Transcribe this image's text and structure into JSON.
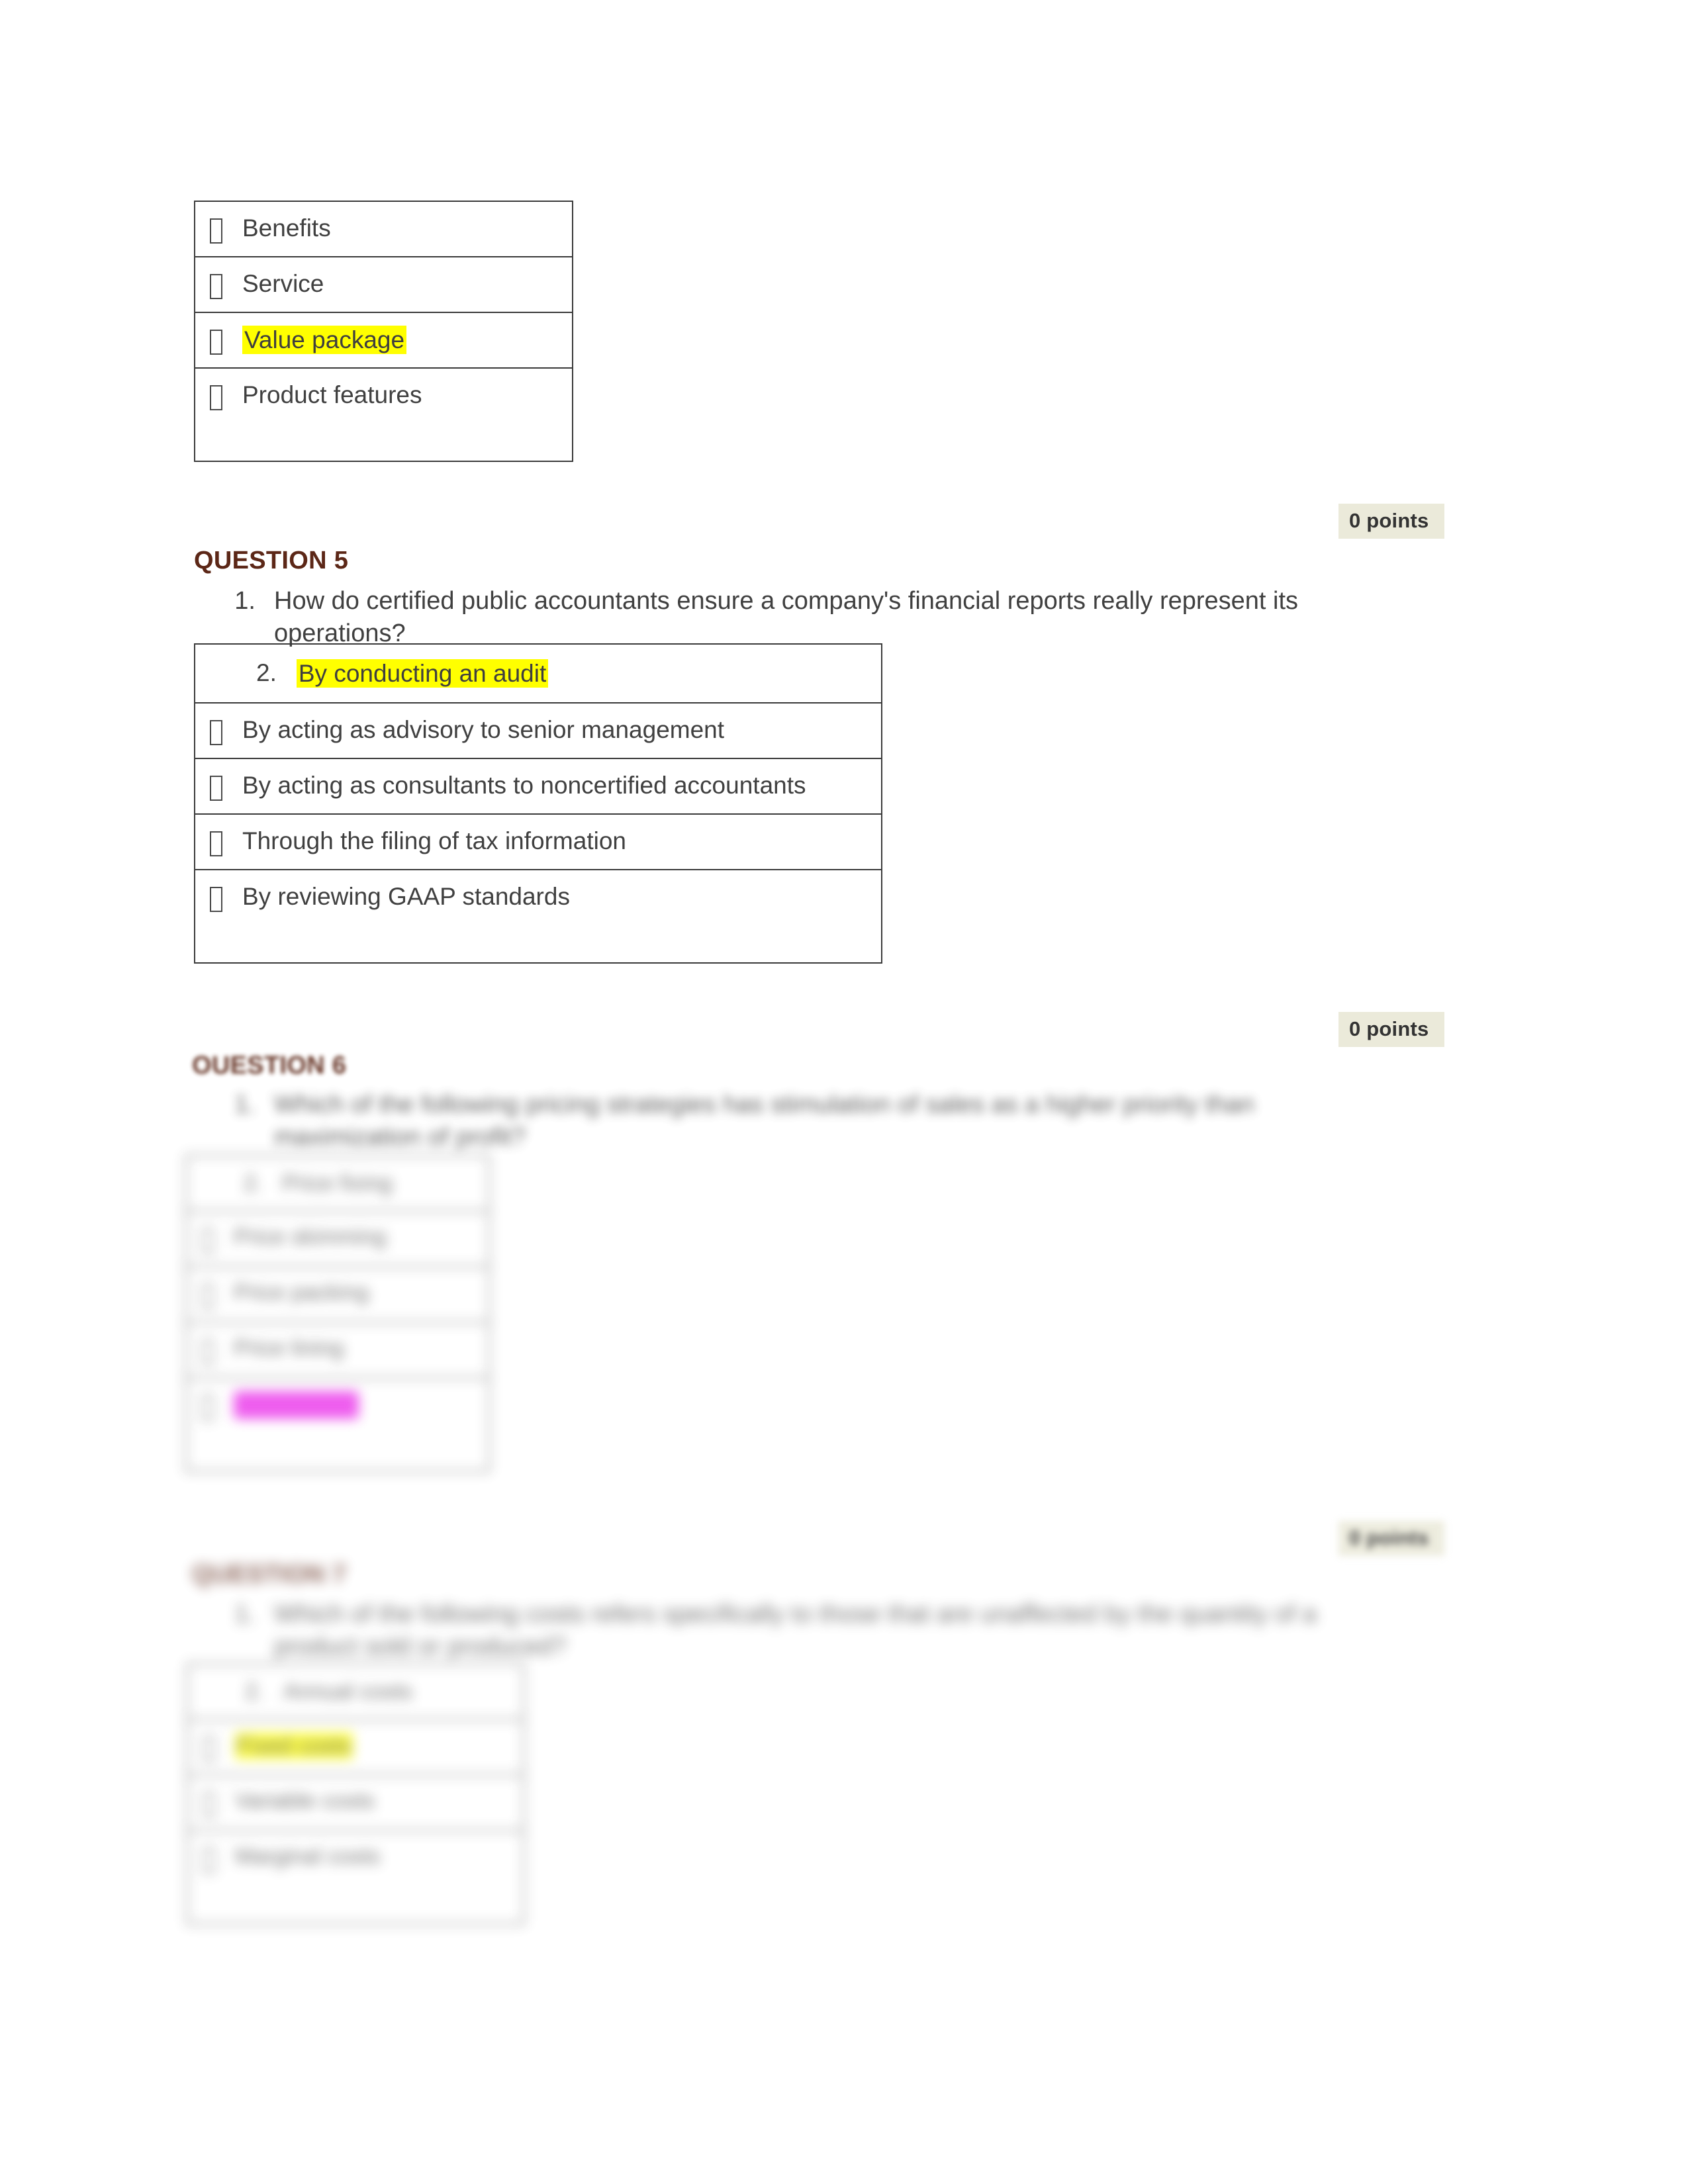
{
  "document": {
    "kind": "quiz-review",
    "page_background": "#ffffff",
    "text_color": "#404040",
    "heading_color": "#5c2717",
    "badge_background": "#ebeada",
    "highlight_yellow": "#ffff00",
    "highlight_magenta": "#e81ee8",
    "table_border_color": "#3a3a3a"
  },
  "question4_options": {
    "bullet_glyph": "missing-glyph-box",
    "rows": [
      {
        "label": "Benefits",
        "highlight": "none"
      },
      {
        "label": "Service",
        "highlight": "none"
      },
      {
        "label": "Value package",
        "highlight": "yellow"
      },
      {
        "label": "Product features",
        "highlight": "none"
      }
    ]
  },
  "badges": {
    "q4_points": "0 points",
    "q5_points": "0 points",
    "q6_points": "0 points"
  },
  "question5": {
    "heading": "QUESTION 5",
    "prompt_number": "1.",
    "prompt": "How do certified public accountants ensure a company's financial reports really represent its operations?",
    "selected_number": "2.",
    "options": [
      {
        "label": "By conducting an audit",
        "highlight": "yellow",
        "marker": "number"
      },
      {
        "label": "By acting as advisory to senior management",
        "highlight": "none",
        "marker": "box"
      },
      {
        "label": "By acting as consultants to noncertified accountants",
        "highlight": "none",
        "marker": "box"
      },
      {
        "label": "Through the filing of tax information",
        "highlight": "none",
        "marker": "box"
      },
      {
        "label": "By reviewing GAAP standards",
        "highlight": "none",
        "marker": "box"
      }
    ]
  },
  "question6": {
    "heading": "OUESTION 6",
    "legibility": "blurred",
    "prompt_number": "1.",
    "prompt_line1": "Which of the following pricing strategies has stimulation of sales as a higher priority than",
    "prompt_line2": "maximization of profit?",
    "selected_number": "2.",
    "options": [
      {
        "label": "Price fixing",
        "highlight": "none",
        "marker": "number"
      },
      {
        "label": "Price skimming",
        "highlight": "none",
        "marker": "box"
      },
      {
        "label": "Price packing",
        "highlight": "none",
        "marker": "box"
      },
      {
        "label": "Price lining",
        "highlight": "none",
        "marker": "box"
      },
      {
        "label": "Price leader",
        "highlight": "magenta",
        "marker": "box"
      }
    ]
  },
  "question7": {
    "heading": "QUESTION 7",
    "legibility": "blurred",
    "prompt_number": "1.",
    "prompt_line1": "Which of the following costs refers specifically to those that are unaffected by the",
    "prompt_line2": "quantity of a product sold or produced?",
    "selected_number": "2.",
    "options": [
      {
        "label": "Annual costs",
        "highlight": "none",
        "marker": "number"
      },
      {
        "label": "Fixed costs",
        "highlight": "yellow",
        "marker": "box"
      },
      {
        "label": "Variable costs",
        "highlight": "none",
        "marker": "box"
      },
      {
        "label": "Marginal costs",
        "highlight": "none",
        "marker": "box"
      }
    ]
  }
}
